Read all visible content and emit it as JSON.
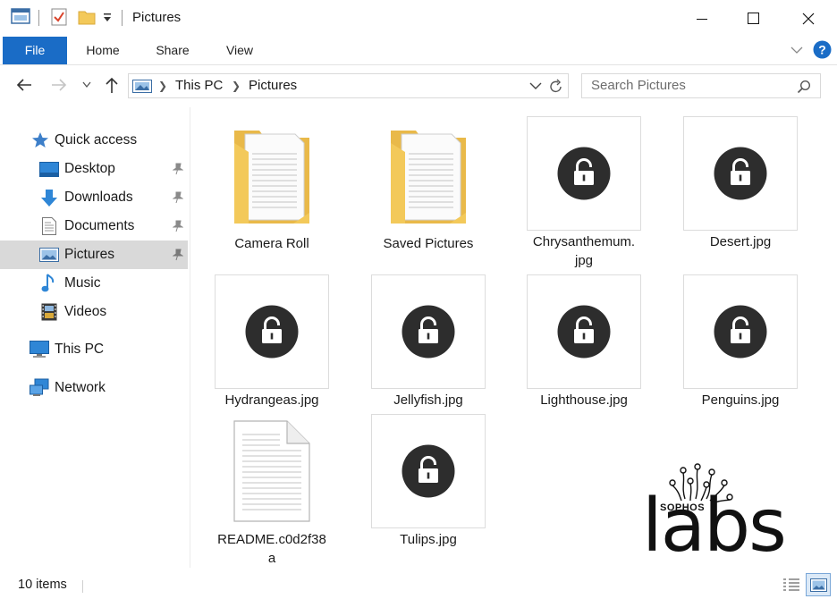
{
  "window": {
    "title": "Pictures"
  },
  "ribbon": {
    "tabs": [
      {
        "label": "File"
      },
      {
        "label": "Home"
      },
      {
        "label": "Share"
      },
      {
        "label": "View"
      }
    ]
  },
  "address": {
    "crumbs": [
      "This PC",
      "Pictures"
    ],
    "search_placeholder": "Search Pictures"
  },
  "sidebar": {
    "items": [
      {
        "label": "Quick access",
        "icon": "star-icon"
      },
      {
        "label": "Desktop",
        "icon": "desktop-icon",
        "pinned": true
      },
      {
        "label": "Downloads",
        "icon": "download-arrow-icon",
        "pinned": true
      },
      {
        "label": "Documents",
        "icon": "documents-icon",
        "pinned": true
      },
      {
        "label": "Pictures",
        "icon": "pictures-icon",
        "pinned": true,
        "selected": true
      },
      {
        "label": "Music",
        "icon": "music-note-icon"
      },
      {
        "label": "Videos",
        "icon": "film-icon"
      },
      {
        "label": "This PC",
        "icon": "computer-icon"
      },
      {
        "label": "Network",
        "icon": "network-icon"
      }
    ]
  },
  "files": [
    {
      "label": "Camera Roll",
      "kind": "folder"
    },
    {
      "label": "Saved Pictures",
      "kind": "folder"
    },
    {
      "label": "Chrysanthemum.\njpg",
      "kind": "locked"
    },
    {
      "label": "Desert.jpg",
      "kind": "locked"
    },
    {
      "label": "Hydrangeas.jpg",
      "kind": "locked"
    },
    {
      "label": "Jellyfish.jpg",
      "kind": "locked"
    },
    {
      "label": "Lighthouse.jpg",
      "kind": "locked"
    },
    {
      "label": "Penguins.jpg",
      "kind": "locked"
    },
    {
      "label": "README.c0d2f38\na",
      "kind": "document"
    },
    {
      "label": "Tulips.jpg",
      "kind": "locked"
    }
  ],
  "status": {
    "item_count": "10 items"
  },
  "watermark": {
    "brand": "SOPHOS",
    "word": "labs"
  },
  "colors": {
    "accent": "#1a6cc6",
    "folder": "#f3c95a",
    "lock_circle": "#2d2d2d",
    "selection": "#d9d9d9"
  }
}
